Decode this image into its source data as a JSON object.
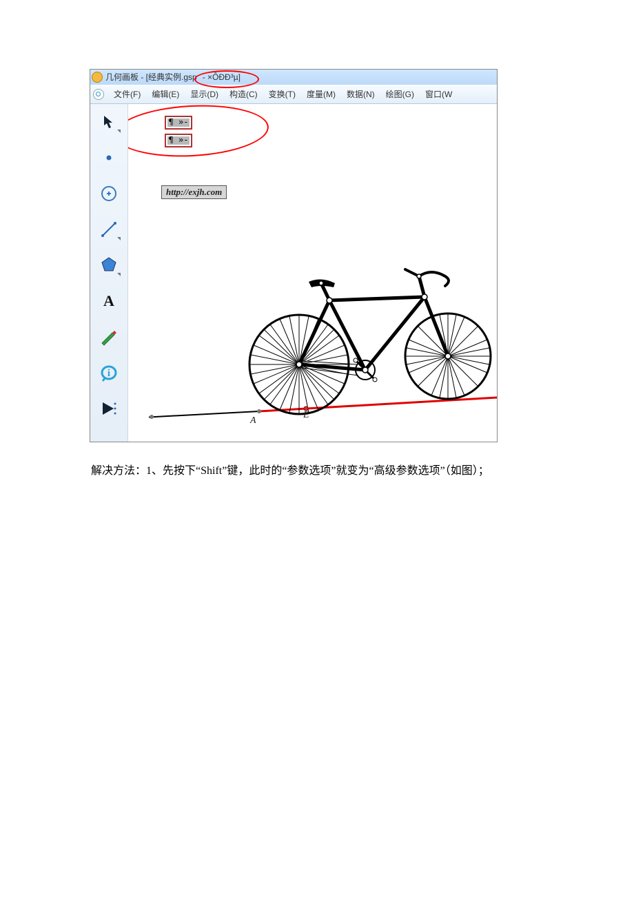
{
  "title_prefix": "几何画板 - [经典实例.gsp",
  "title_garbled": " - ×ÔÐÐ³µ]",
  "menu": {
    "file": "文件(F)",
    "edit": "编辑(E)",
    "display": "显示(D)",
    "construct": "构造(C)",
    "transform": "变换(T)",
    "measure": "度量(M)",
    "data": "数据(N)",
    "graph": "绘图(G)",
    "window": "窗口(W"
  },
  "action_btn_label": "¶ »-",
  "url_text": "http://exjh.com",
  "point_labels": {
    "A": "A",
    "E": "E"
  },
  "tools": {
    "arrow": "arrow-tool",
    "point": "point-tool",
    "circle": "circle-tool",
    "line": "line-tool",
    "polygon": "polygon-tool",
    "text": "text-tool",
    "marker": "marker-tool",
    "info": "info-tool",
    "custom": "custom-tool"
  },
  "paragraph": "解决方法：1、先按下“Shift”键，此时的“参数选项”就变为“高级参数选项”（如图）；"
}
